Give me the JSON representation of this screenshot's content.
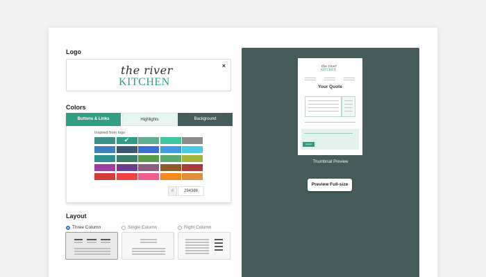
{
  "logo": {
    "title": "Logo",
    "script_text": "the river",
    "kitchen_text": "KITCHEN",
    "close_icon": "×"
  },
  "colors": {
    "title": "Colors",
    "tabs": [
      "Buttons & Links",
      "Highlights",
      "Background"
    ],
    "active_tab": "Buttons & Links",
    "inspired_label": "Inspired from logo",
    "selected_swatch": "#2f9e84",
    "swatches": [
      [
        "#3e9089",
        "#2f9e84",
        "#5fae92",
        "#3fc7a0",
        "#8b8b8b"
      ],
      [
        "#3f7fbf",
        "#3e5873",
        "#3b6fd1",
        "#3e9be0",
        "#4bc8e2"
      ],
      [
        "#2f8f8f",
        "#3b7f6a",
        "#5a9b4a",
        "#5bab6f",
        "#a4b33a"
      ],
      [
        "#9e3fa0",
        "#6a3f8f",
        "#8a5f7f",
        "#8f5b2a",
        "#a83b3b"
      ],
      [
        "#d43b3b",
        "#f04444",
        "#f05d8c",
        "#f48a1e",
        "#e08f3a"
      ]
    ],
    "hash": "#",
    "hex_value": "294386"
  },
  "layout": {
    "title": "Layout",
    "options": [
      "Three Column",
      "Single Column",
      "Right Column"
    ],
    "selected": "Three Column"
  },
  "preview": {
    "doc_script": "the river",
    "doc_kitchen": "KITCHEN",
    "doc_quote_title": "Your Quote",
    "accept_label": "Accept",
    "thumbnail_label": "Thumbnail Preview",
    "button_label": "Preview Full-size",
    "panel_color": "#475c5a"
  }
}
